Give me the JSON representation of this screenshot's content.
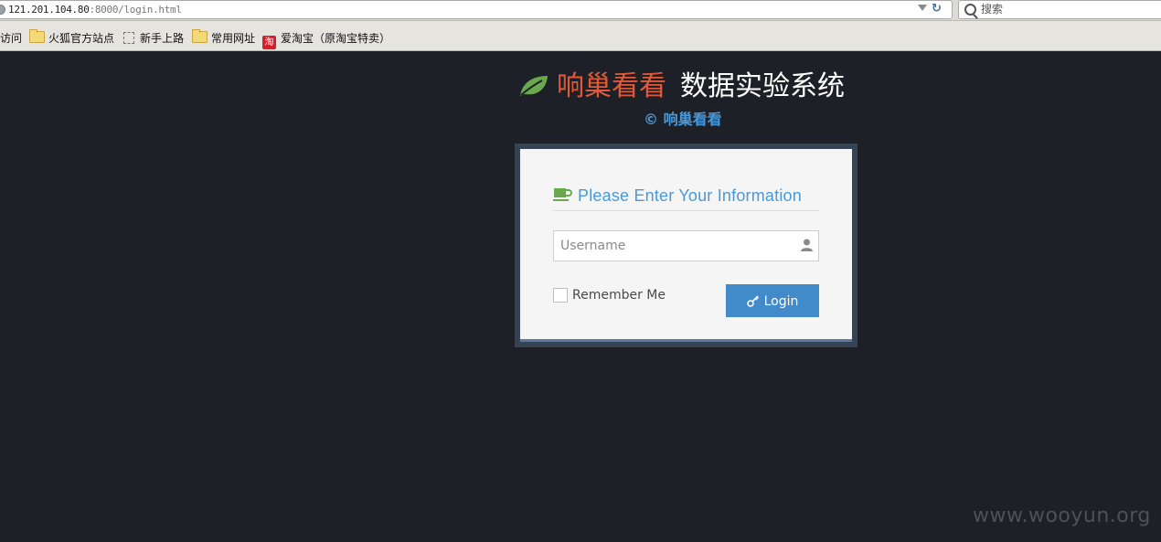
{
  "browser": {
    "url_host": "121.201.104.80",
    "url_rest": ":8000/login.html",
    "search_placeholder": "搜索",
    "bookmarks": [
      {
        "label": "访问",
        "icon": "none"
      },
      {
        "label": "火狐官方站点",
        "icon": "folder-icon"
      },
      {
        "label": "新手上路",
        "icon": "page-icon"
      },
      {
        "label": "常用网址",
        "icon": "folder-icon"
      },
      {
        "label": "爱淘宝（原淘宝特卖）",
        "icon": "taobao-icon",
        "icon_text": "淘"
      }
    ]
  },
  "header": {
    "brand_red": "响巢看看",
    "brand_white": "数据实验系统",
    "copyright": "© 响巢看看"
  },
  "login_form": {
    "title": "Please Enter Your Information",
    "username_placeholder": "Username",
    "username_value": "",
    "remember_label": "Remember Me",
    "remember_checked": false,
    "login_button": "Login"
  },
  "watermark": "www.wooyun.org",
  "colors": {
    "background": "#1d2026",
    "brand_red": "#e05a3a",
    "accent_blue": "#4a98d8",
    "leaf_green": "#6aa84f",
    "button_blue": "#428bca"
  }
}
